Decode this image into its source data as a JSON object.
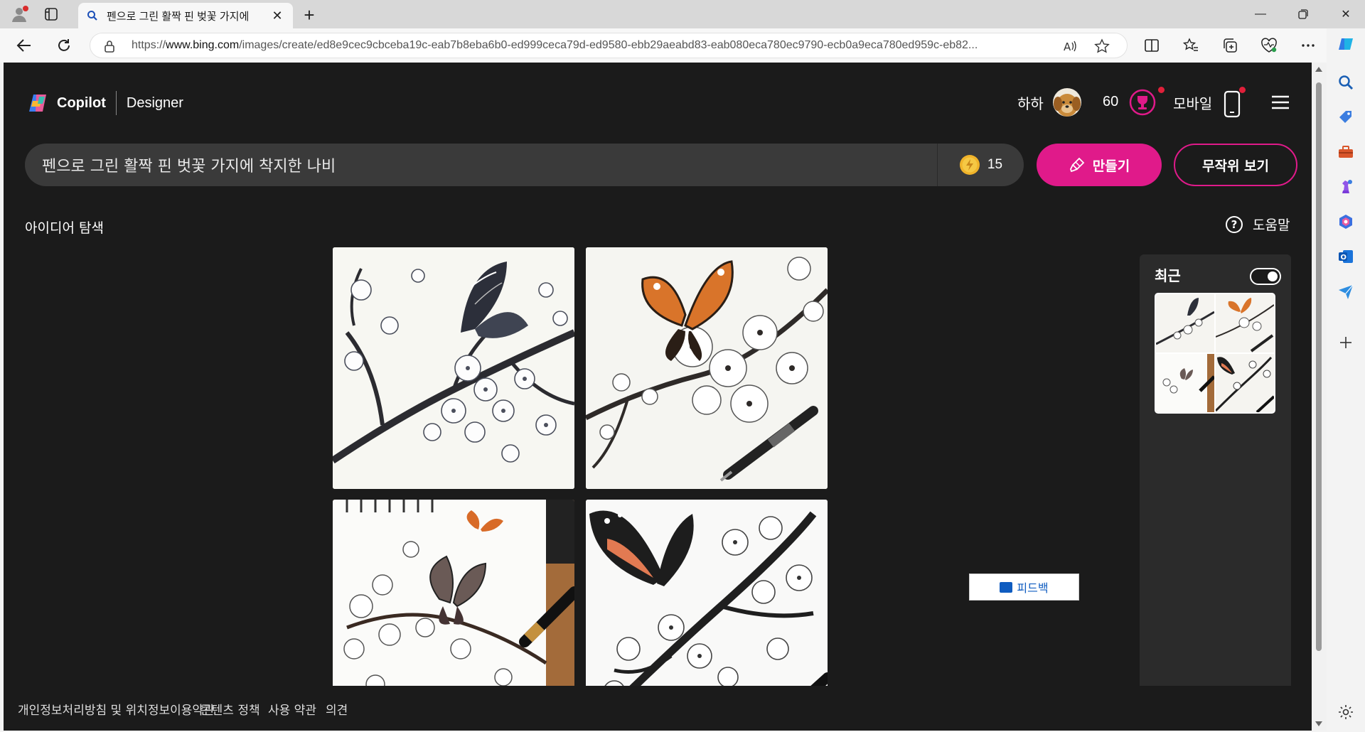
{
  "browser": {
    "tab_title": "펜으로 그린 활짝 핀 벚꽃 가지에",
    "url_prefix": "https://",
    "url_domain": "www.bing.com",
    "url_rest": "/images/create/ed8e9cec9cbceba19c-eab7b8eba6b0-ed999ceca79d-ed9580-ebb29aeabd83-eab080eca780ec9790-ecb0a9eca780ed959c-eb82..."
  },
  "header": {
    "brand_copilot": "Copilot",
    "brand_designer": "Designer",
    "user_name": "하하",
    "points": "60",
    "mobile_label": "모바일"
  },
  "search": {
    "prompt_value": "펜으로 그린 활짝 핀 벗꽃 가지에 착지한 나비",
    "boost_count": "15",
    "create_label": "만들기",
    "surprise_label": "무작위 보기"
  },
  "explore_label": "아이디어 탐색",
  "help_label": "도움말",
  "recent": {
    "title": "최근",
    "toggle_on": true
  },
  "images": [
    {
      "name": "butterfly-black-white-blossoms"
    },
    {
      "name": "orange-butterfly-with-pen"
    },
    {
      "name": "butterflies-on-sketchbook"
    },
    {
      "name": "red-admiral-on-branch"
    }
  ],
  "footer": {
    "privacy": "개인정보처리방침 및 위치정보이용약관",
    "content_policy": "콘텐츠 정책",
    "terms": "사용 약관",
    "feedback_link": "의견",
    "feedback_button": "피드백"
  },
  "colors": {
    "accent": "#e01a8a",
    "page_bg": "#1b1b1b",
    "search_bg": "#3a3a3a"
  }
}
